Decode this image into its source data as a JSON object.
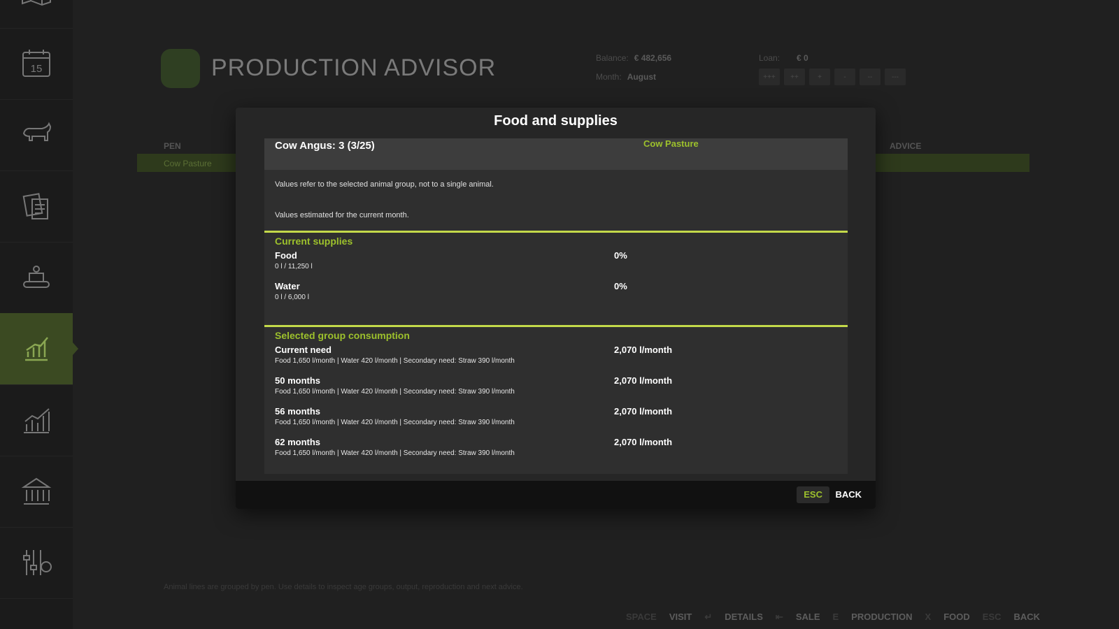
{
  "background": {
    "title": "PRODUCTION ADVISOR",
    "balance_label": "Balance:",
    "balance_value": "€ 482,656",
    "month_label": "Month:",
    "month_value": "August",
    "loan_label": "Loan:",
    "loan_value": "€ 0",
    "speed_buttons": [
      "+++",
      "++",
      "+",
      "-",
      "--",
      "---"
    ],
    "columns": {
      "pen": "PEN",
      "advice": "ADVICE"
    },
    "row": {
      "pen": "Cow Pasture"
    },
    "hint": "Animal lines are grouped by pen. Use details to inspect age groups, output, reproduction and next advice.",
    "footer": [
      {
        "key": "SPACE",
        "label": "VISIT"
      },
      {
        "key": "↵",
        "label": "DETAILS"
      },
      {
        "key": "⇤",
        "label": "SALE"
      },
      {
        "key": "E",
        "label": "PRODUCTION"
      },
      {
        "key": "X",
        "label": "FOOD"
      },
      {
        "key": "ESC",
        "label": "BACK"
      }
    ]
  },
  "modal": {
    "title": "Food and supplies",
    "animal": "Cow Angus: 3 (3/25)",
    "pen": "Cow Pasture",
    "note1": "Values refer to the selected animal group, not to a single animal.",
    "note2": "Values estimated for the current month.",
    "supplies": {
      "title": "Current supplies",
      "items": [
        {
          "label": "Food",
          "sub": "0 l / 11,250 l",
          "value": "0%"
        },
        {
          "label": "Water",
          "sub": "0 l / 6,000 l",
          "value": "0%"
        }
      ]
    },
    "consumption": {
      "title": "Selected group consumption",
      "items": [
        {
          "label": "Current need",
          "sub": "Food 1,650 l/month | Water 420 l/month | Secondary need: Straw 390 l/month",
          "value": "2,070 l/month"
        },
        {
          "label": "50 months",
          "sub": "Food 1,650 l/month | Water 420 l/month | Secondary need: Straw 390 l/month",
          "value": "2,070 l/month"
        },
        {
          "label": "56 months",
          "sub": "Food 1,650 l/month | Water 420 l/month | Secondary need: Straw 390 l/month",
          "value": "2,070 l/month"
        },
        {
          "label": "62 months",
          "sub": "Food 1,650 l/month | Water 420 l/month | Secondary need: Straw 390 l/month",
          "value": "2,070 l/month"
        }
      ]
    },
    "footer": {
      "esc_key": "ESC",
      "back_label": "BACK"
    }
  },
  "sidebar": {
    "calendar_day": "15",
    "icons": [
      "map-icon",
      "calendar-icon",
      "livestock-icon",
      "contracts-icon",
      "production-icon",
      "advisor-icon",
      "statistics-icon",
      "finances-icon",
      "settings-icon"
    ]
  },
  "colors": {
    "accent": "#9dc12c",
    "divider": "#c3d94a",
    "sidebar_active": "#3b4a22"
  }
}
